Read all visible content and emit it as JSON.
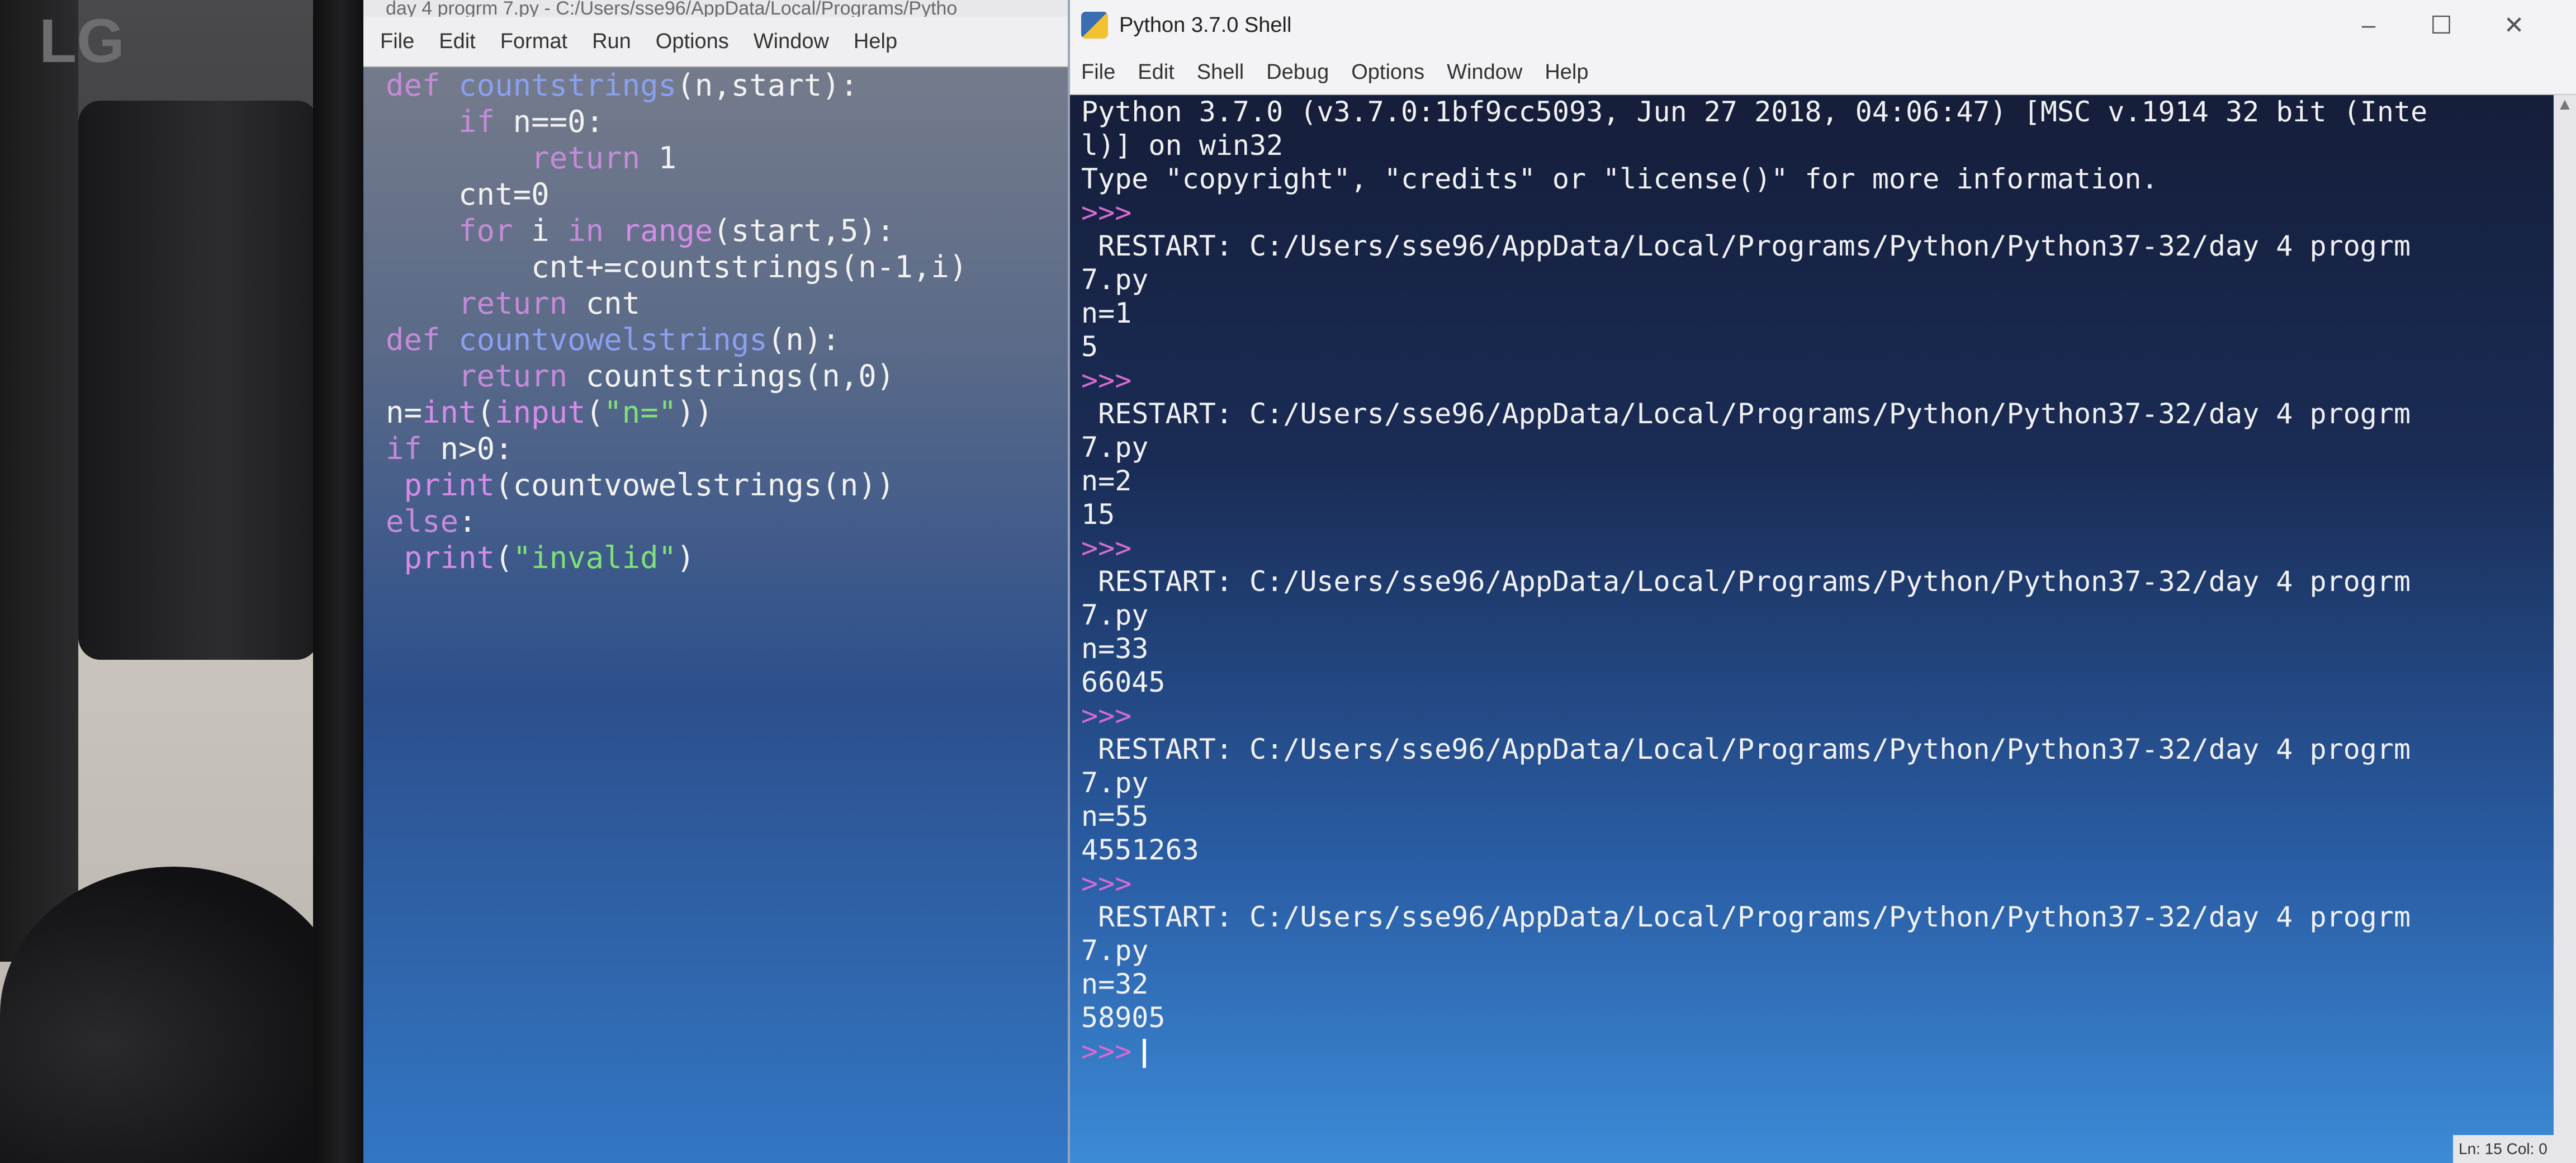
{
  "environment": {
    "monitor_brand": "LG"
  },
  "editor": {
    "title": "day 4 progrm 7.py - C:/Users/sse96/AppData/Local/Programs/Pytho",
    "menu": [
      "File",
      "Edit",
      "Format",
      "Run",
      "Options",
      "Window",
      "Help"
    ],
    "code_lines": [
      "def countstrings(n,start):",
      "    if n==0:",
      "        return 1",
      "    cnt=0",
      "    for i in range(start,5):",
      "        cnt+=countstrings(n-1,i)",
      "    return cnt",
      "def countvowelstrings(n):",
      "    return countstrings(n,0)",
      "n=int(input(\"n=\"))",
      "if n>0:",
      " print(countvowelstrings(n))",
      "else:",
      " print(\"invalid\")"
    ]
  },
  "shell": {
    "title": "Python 3.7.0 Shell",
    "menu": [
      "File",
      "Edit",
      "Shell",
      "Debug",
      "Options",
      "Window",
      "Help"
    ],
    "window_controls": [
      "–",
      "☐",
      "✕"
    ],
    "lines": [
      "Python 3.7.0 (v3.7.0:1bf9cc5093, Jun 27 2018, 04:06:47) [MSC v.1914 32 bit (Inte",
      "l)] on win32",
      "Type \"copyright\", \"credits\" or \"license()\" for more information.",
      ">>>",
      " RESTART: C:/Users/sse96/AppData/Local/Programs/Python/Python37-32/day 4 progrm",
      "7.py",
      "n=1",
      "5",
      ">>>",
      " RESTART: C:/Users/sse96/AppData/Local/Programs/Python/Python37-32/day 4 progrm",
      "7.py",
      "n=2",
      "15",
      ">>>",
      " RESTART: C:/Users/sse96/AppData/Local/Programs/Python/Python37-32/day 4 progrm",
      "7.py",
      "n=33",
      "66045",
      ">>>",
      " RESTART: C:/Users/sse96/AppData/Local/Programs/Python/Python37-32/day 4 progrm",
      "7.py",
      "n=55",
      "4551263",
      ">>>",
      " RESTART: C:/Users/sse96/AppData/Local/Programs/Python/Python37-32/day 4 progrm",
      "7.py",
      "n=32",
      "58905"
    ],
    "final_prompt": ">>>",
    "status": "Ln: 15   Col: 0"
  }
}
